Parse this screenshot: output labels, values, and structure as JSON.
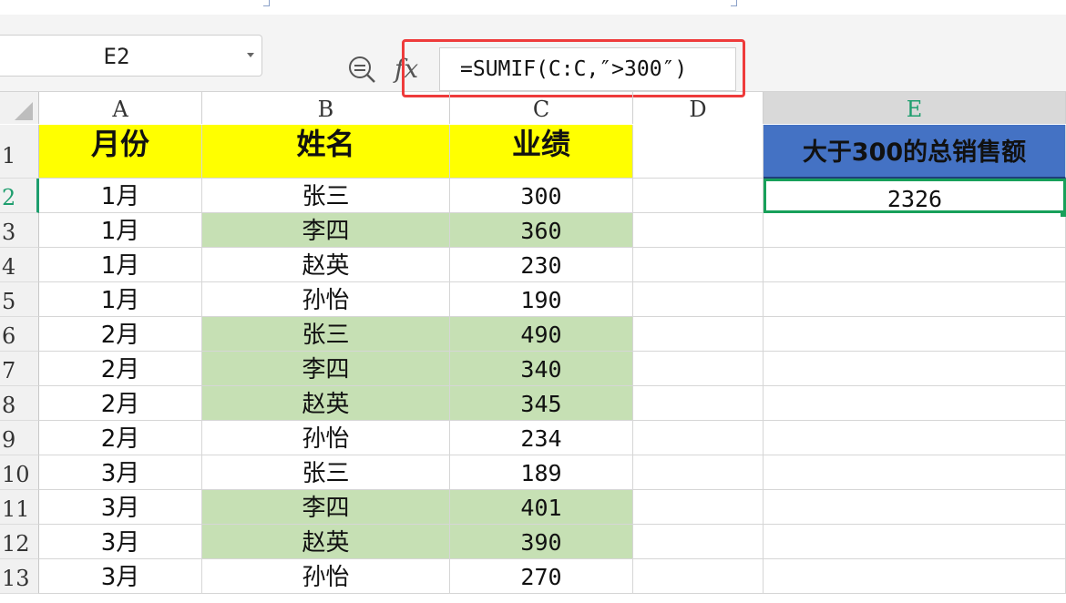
{
  "formula_bar": {
    "name_box": "E2",
    "zoom_icon": "zoom-out-icon",
    "fx_label": "fx",
    "formula": "=SUMIF(C:C,″>300″)"
  },
  "columns": [
    "A",
    "B",
    "C",
    "D",
    "E"
  ],
  "rows": [
    "1",
    "2",
    "3",
    "4",
    "5",
    "6",
    "7",
    "8",
    "9",
    "10",
    "11",
    "12",
    "13"
  ],
  "table": {
    "headers": [
      "月份",
      "姓名",
      "业绩"
    ],
    "data": [
      {
        "month": "1月",
        "name": "张三",
        "score": "300",
        "green": false
      },
      {
        "month": "1月",
        "name": "李四",
        "score": "360",
        "green": true
      },
      {
        "month": "1月",
        "name": "赵英",
        "score": "230",
        "green": false
      },
      {
        "month": "1月",
        "name": "孙怡",
        "score": "190",
        "green": false
      },
      {
        "month": "2月",
        "name": "张三",
        "score": "490",
        "green": true
      },
      {
        "month": "2月",
        "name": "李四",
        "score": "340",
        "green": true
      },
      {
        "month": "2月",
        "name": "赵英",
        "score": "345",
        "green": true
      },
      {
        "month": "2月",
        "name": "孙怡",
        "score": "234",
        "green": false
      },
      {
        "month": "3月",
        "name": "张三",
        "score": "189",
        "green": false
      },
      {
        "month": "3月",
        "name": "李四",
        "score": "401",
        "green": true
      },
      {
        "month": "3月",
        "name": "赵英",
        "score": "390",
        "green": true
      },
      {
        "month": "3月",
        "name": "孙怡",
        "score": "270",
        "green": false
      }
    ]
  },
  "result": {
    "header": "大于300的总销售额",
    "value": "2326"
  },
  "colors": {
    "header_fill": "#ffff00",
    "highlight_fill": "#c6e0b4",
    "result_header_fill": "#4472c4",
    "selection": "#18a05a",
    "formula_highlight": "#ee3b3b"
  }
}
